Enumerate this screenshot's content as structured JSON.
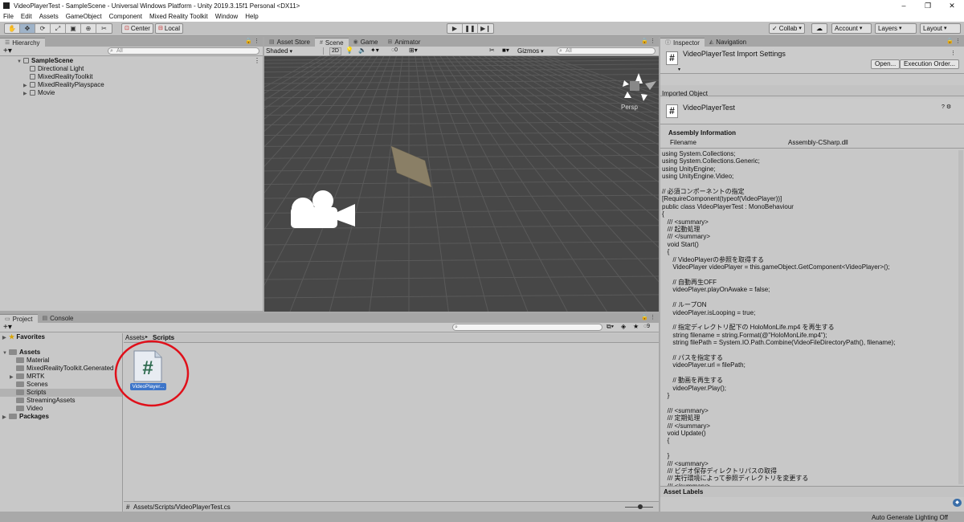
{
  "window": {
    "title": "VideoPlayerTest - SampleScene - Universal Windows Platform - Unity 2019.3.15f1 Personal <DX11>",
    "minimize": "–",
    "maximize": "❐",
    "close": "✕"
  },
  "menu": [
    "File",
    "Edit",
    "Assets",
    "GameObject",
    "Component",
    "Mixed Reality Toolkit",
    "Window",
    "Help"
  ],
  "toolbar": {
    "tools": [
      "✋",
      "✥",
      "⟳",
      "⤢",
      "▣",
      "⊕",
      "✂"
    ],
    "pivot_label": "Center",
    "space_label": "Local",
    "play": "▶",
    "pause": "❚❚",
    "step": "▶❙",
    "collab_label": "Collab",
    "account_label": "Account",
    "layers_label": "Layers",
    "layout_label": "Layout"
  },
  "hierarchy": {
    "tab": "Hierarchy",
    "search_placeholder": "All",
    "scene": "SampleScene",
    "items": [
      "Directional Light",
      "MixedRealityToolkit",
      "MixedRealityPlayspace",
      "Movie"
    ]
  },
  "scene": {
    "tabs": [
      "Asset Store",
      "Scene",
      "Game",
      "Animator"
    ],
    "shading": "Shaded",
    "mode_2d": "2D",
    "hidden_count": "0",
    "gizmos": "Gizmos",
    "search_placeholder": "All",
    "persp_label": "Persp"
  },
  "project": {
    "tabs": [
      "Project",
      "Console"
    ],
    "favorites": "Favorites",
    "assets": "Assets",
    "folders": [
      "Material",
      "MixedRealityToolkit.Generated",
      "MRTK",
      "Scenes",
      "Scripts",
      "StreamingAssets",
      "Video"
    ],
    "packages": "Packages",
    "breadcrumb_root": "Assets",
    "breadcrumb_sep": "▸",
    "breadcrumb_current": "Scripts",
    "hidden_count": "9",
    "asset_label": "VideoPlayer...",
    "path": "Assets/Scripts/VideoPlayerTest.cs"
  },
  "inspector": {
    "tabs": [
      "Inspector",
      "Navigation"
    ],
    "import_title": "VideoPlayerTest Import Settings",
    "open_label": "Open...",
    "exec_order_label": "Execution Order...",
    "imported_object": "Imported Object",
    "object_name": "VideoPlayerTest",
    "assembly_info": "Assembly Information",
    "filename_label": "Filename",
    "filename_value": "Assembly-CSharp.dll",
    "code": [
      "using System.Collections;",
      "using System.Collections.Generic;",
      "using UnityEngine;",
      "using UnityEngine.Video;",
      "",
      "// 必須コンポーネントの指定",
      "[RequireComponent(typeof(VideoPlayer))]",
      "public class VideoPlayerTest : MonoBehaviour",
      "{",
      "   /// <summary>",
      "   /// 起動処理",
      "   /// </summary>",
      "   void Start()",
      "   {",
      "      // VideoPlayerの参照を取得する",
      "      VideoPlayer videoPlayer = this.gameObject.GetComponent<VideoPlayer>();",
      "",
      "      // 自動再生OFF",
      "      videoPlayer.playOnAwake = false;",
      "",
      "      // ループON",
      "      videoPlayer.isLooping = true;",
      "",
      "      // 指定ディレクトリ配下の HoloMonLife.mp4 を再生する",
      "      string filename = string.Format(@\"HoloMonLife.mp4\");",
      "      string filePath = System.IO.Path.Combine(VideoFileDirectoryPath(), filename);",
      "",
      "      // パスを指定する",
      "      videoPlayer.url = filePath;",
      "",
      "      // 動画を再生する",
      "      videoPlayer.Play();",
      "   }",
      "",
      "   /// <summary>",
      "   /// 定期処理",
      "   /// </summary>",
      "   void Update()",
      "   {",
      "",
      "   }",
      "   /// <summary>",
      "   /// ビデオ保存ディレクトリパスの取得",
      "   /// 実行環境によって参照ディレクトリを変更する",
      "   /// </summary>"
    ],
    "asset_labels": "Asset Labels"
  },
  "status": {
    "lighting": "Auto Generate Lighting Off"
  }
}
